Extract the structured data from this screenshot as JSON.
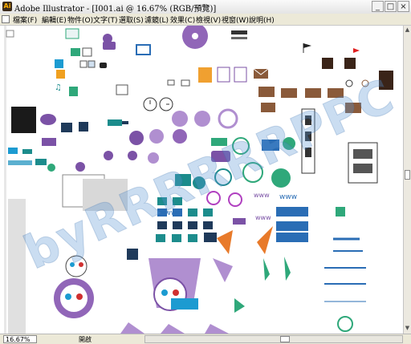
{
  "window": {
    "title": "Adobe Illustrator - [I001.ai @ 16.67% (RGB/預覽)]",
    "app_icon_text": "Ai",
    "minimize": "_",
    "maximize": "□",
    "close": "×"
  },
  "menubar": {
    "items": [
      "檔案(F)",
      "編輯(E)",
      "物件(O)",
      "文字(T)",
      "選取(S)",
      "濾鏡(L)",
      "效果(C)",
      "檢視(V)",
      "視窗(W)",
      "說明(H)"
    ]
  },
  "canvas": {
    "watermark": "byRRRRRRPPC",
    "artwork_labels": {
      "www": "www"
    }
  },
  "statusbar": {
    "zoom": "16.67%",
    "label": "開啟"
  },
  "colors": {
    "purple": "#7b52a6",
    "lavender": "#b08fd0",
    "brown": "#8a5a3a",
    "dark_brown": "#3a2418",
    "teal": "#1c8c8c",
    "green": "#2fa87a",
    "blue": "#2a6db5",
    "orange": "#e87a2a",
    "watermark": "#5a96d2"
  }
}
